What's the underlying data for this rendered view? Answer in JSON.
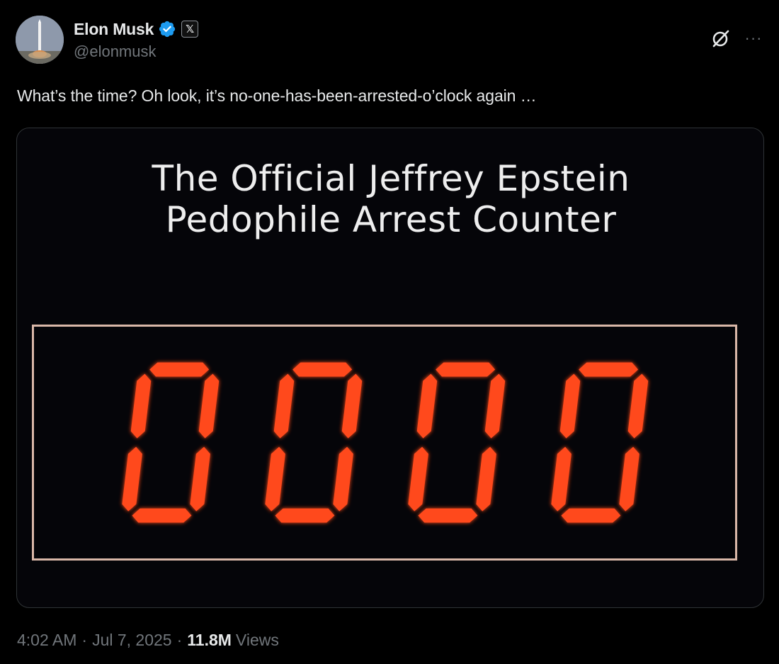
{
  "author": {
    "display_name": "Elon Musk",
    "handle": "@elonmusk",
    "verified": true,
    "verified_color": "#1d9bf0",
    "affiliation_icon": "x-logo-icon"
  },
  "actions": {
    "grok_icon": "grok-icon",
    "more_icon": "more-options-icon",
    "more_label": "···"
  },
  "tweet": {
    "text": "What’s the time? Oh look, it’s no-one-has-been-arrested-o’clock again …"
  },
  "media": {
    "title_line1": "The Official Jeffrey Epstein",
    "title_line2": "Pedophile Arrest Counter",
    "counter_value": "0000",
    "digit_color": "#ff4a1a",
    "frame_color": "#d9b7a8"
  },
  "meta": {
    "time": "4:02 AM",
    "date": "Jul 7, 2025",
    "views_count": "11.8M",
    "views_label": "Views",
    "separator": "·"
  }
}
